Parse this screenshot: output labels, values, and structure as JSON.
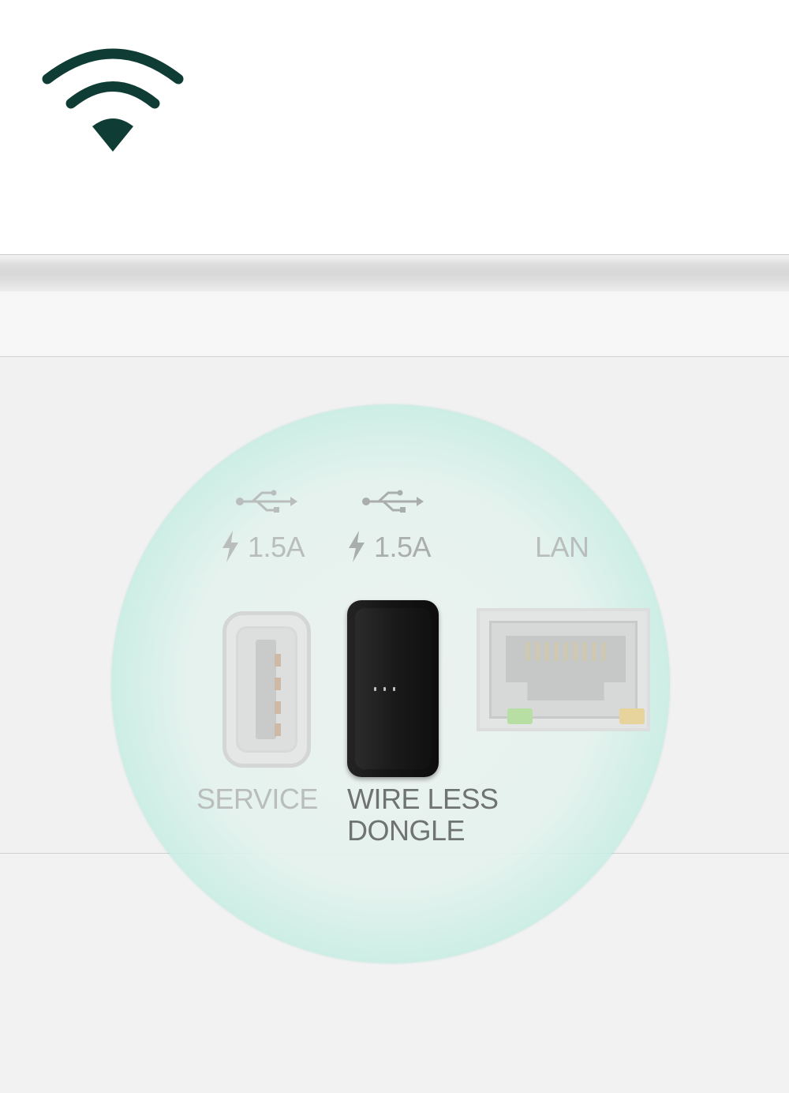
{
  "colors": {
    "wifi_icon": "#0f3d35",
    "highlight": "#5fd2ba",
    "dongle": "#151515",
    "label_muted": "#b9bdbc",
    "label_dark": "#6f7372"
  },
  "icons": {
    "wifi": "wifi-icon",
    "usb": "usb-icon",
    "bolt": "bolt-icon"
  },
  "ports": {
    "service": {
      "current": "1.5A",
      "label": "SERVICE"
    },
    "dongle": {
      "current": "1.5A",
      "label_line1": "WIRE LESS",
      "label_line2": "DONGLE"
    },
    "lan": {
      "label": "LAN"
    }
  }
}
